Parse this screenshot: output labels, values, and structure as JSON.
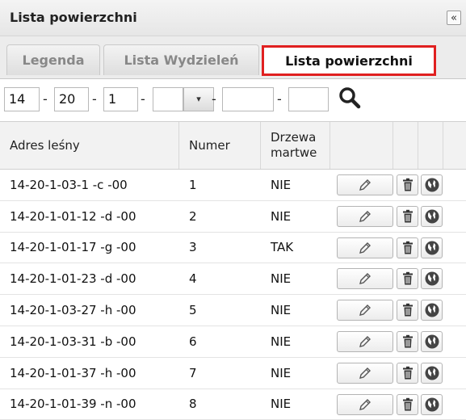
{
  "panel": {
    "title": "Lista powierzchni",
    "collapse_glyph": "«"
  },
  "tabs": [
    {
      "label": "Legenda",
      "active": false
    },
    {
      "label": "Lista Wydzieleń",
      "active": false
    },
    {
      "label": "Lista powierzchni",
      "active": true
    }
  ],
  "filter": {
    "fields": [
      "14",
      "20",
      "1",
      "",
      "",
      "",
      ""
    ],
    "separator": "-",
    "dropdown_glyph": "▾",
    "search_icon": "magnifier-icon"
  },
  "table": {
    "headers": [
      "Adres leśny",
      "Numer",
      "Drzewa martwe",
      "",
      "",
      "",
      ""
    ],
    "rows": [
      {
        "adres": "14-20-1-03-1 -c -00",
        "numer": "1",
        "martwe": "NIE"
      },
      {
        "adres": "14-20-1-01-12 -d -00",
        "numer": "2",
        "martwe": "NIE"
      },
      {
        "adres": "14-20-1-01-17 -g -00",
        "numer": "3",
        "martwe": "TAK"
      },
      {
        "adres": "14-20-1-01-23 -d -00",
        "numer": "4",
        "martwe": "NIE"
      },
      {
        "adres": "14-20-1-03-27 -h -00",
        "numer": "5",
        "martwe": "NIE"
      },
      {
        "adres": "14-20-1-03-31 -b -00",
        "numer": "6",
        "martwe": "NIE"
      },
      {
        "adres": "14-20-1-01-37 -h -00",
        "numer": "7",
        "martwe": "NIE"
      },
      {
        "adres": "14-20-1-01-39 -n -00",
        "numer": "8",
        "martwe": "NIE"
      }
    ],
    "row_icons": [
      "pencil-icon",
      "trash-icon",
      "globe-icon"
    ]
  },
  "colors": {
    "active_tab_border": "#e02020",
    "header_bg": "#f2f2f2"
  }
}
